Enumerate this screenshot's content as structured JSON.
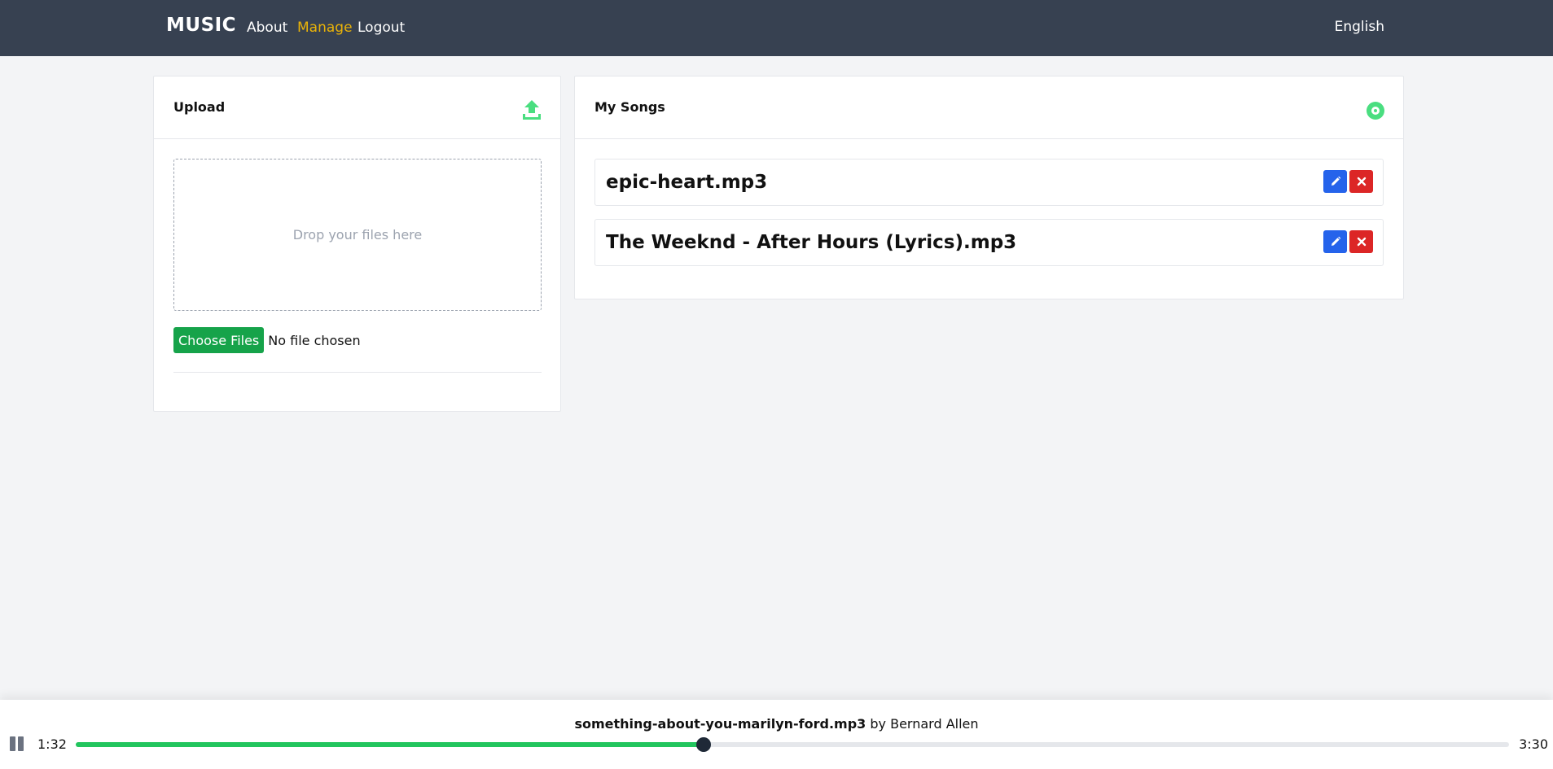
{
  "header": {
    "brand": "MUSIC",
    "nav": {
      "about": "About",
      "manage": "Manage",
      "logout": "Logout"
    },
    "language": "English",
    "active_color": "#eab308"
  },
  "upload": {
    "title": "Upload",
    "dropzone_text": "Drop your files here",
    "choose_files": "Choose Files",
    "no_file": "No file chosen",
    "icon": "upload-icon"
  },
  "songs": {
    "title": "My Songs",
    "icon": "disc-icon",
    "items": [
      {
        "name": "epic-heart.mp3"
      },
      {
        "name": "The Weeknd - After Hours (Lyrics).mp3"
      }
    ]
  },
  "player": {
    "song": "something-about-you-marilyn-ford.mp3",
    "by": "by",
    "artist": "Bernard Allen",
    "current_time": "1:32",
    "duration": "3:30",
    "progress_fraction": 0.438
  },
  "colors": {
    "nav_bg": "#374151",
    "accent_green": "#22c55e",
    "edit_blue": "#2563eb",
    "delete_red": "#dc2626"
  }
}
